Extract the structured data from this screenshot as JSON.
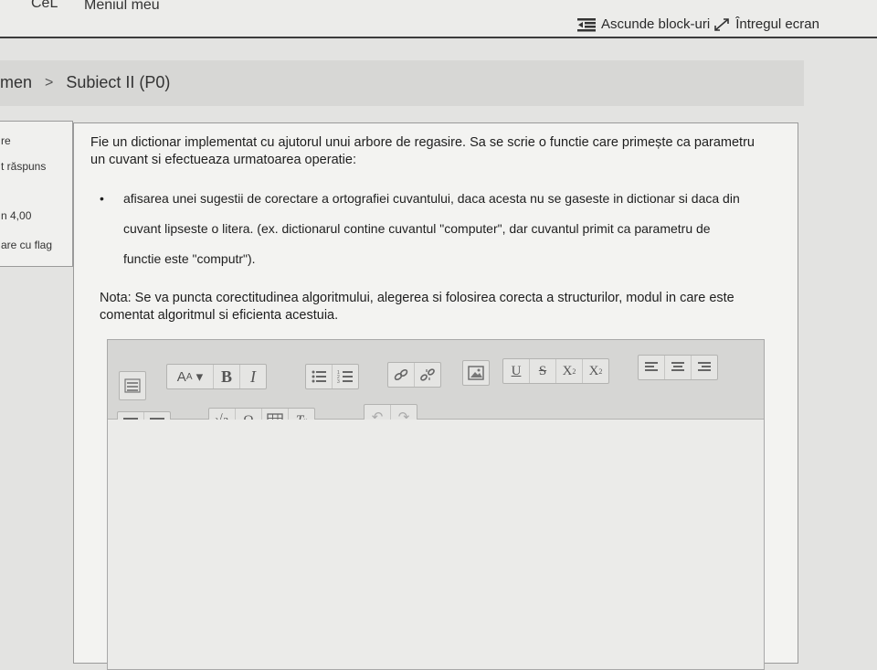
{
  "topbar": {
    "brand": "CeL",
    "user_menu": "Meniul meu",
    "hide_blocks": "Ascunde block-uri",
    "fullscreen": "Întregul ecran"
  },
  "breadcrumb": {
    "item1": "men",
    "item2": "Subiect II (P0)"
  },
  "info": {
    "line1": "re",
    "line2": "t răspuns",
    "line3": "n 4,00",
    "line4": "are cu flag"
  },
  "question": {
    "intro": "Fie un dictionar implementat cu ajutorul unui arbore de regasire. Sa se scrie o functie care primește ca parametru un cuvant si efectueaza urmatoarea operatie:",
    "bullet": "afisarea unei sugestii de corectare a ortografiei cuvantului, daca acesta nu se gaseste in dictionar si daca din cuvant lipseste o litera. (ex. dictionarul contine cuvantul \"computer\", dar cuvantul primit ca parametru de functie este \"computr\").",
    "nota": "Nota: Se va puncta corectitudinea algoritmului, alegerea si folosirea corecta a structurilor, modul in care este comentat algoritmul si eficienta acestuia."
  },
  "editor": {
    "content": "",
    "icons": [
      "toolbar-toggle-icon",
      "font-size-icon",
      "bold-icon",
      "italic-icon",
      "bullet-list-icon",
      "numbered-list-icon",
      "link-icon",
      "unlink-icon",
      "image-icon",
      "underline-icon",
      "strikethrough-icon",
      "subscript-icon",
      "superscript-icon",
      "align-left-icon",
      "align-center-icon",
      "align-right-icon",
      "outdent-icon",
      "indent-icon",
      "equation-icon",
      "special-char-icon",
      "table-icon",
      "clear-format-icon",
      "undo-icon",
      "redo-icon"
    ]
  }
}
